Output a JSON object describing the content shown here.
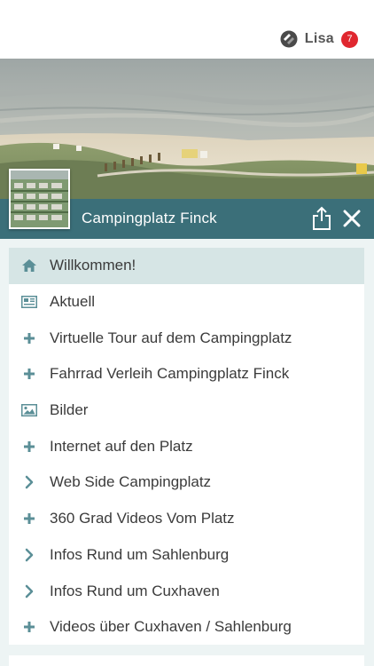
{
  "header": {
    "username": "Lisa",
    "badge_count": "7"
  },
  "camp": {
    "title": "Campingplatz Finck"
  },
  "colors": {
    "accent": "#3b6f79",
    "active_row": "#d6e5e5",
    "icon": "#5b8f97",
    "badge": "#e0272f"
  },
  "menu": {
    "items": [
      {
        "label": "Willkommen!",
        "icon": "home-icon",
        "active": true
      },
      {
        "label": "Aktuell",
        "icon": "newspaper-icon",
        "active": false
      },
      {
        "label": "Virtuelle Tour auf dem Campingplatz",
        "icon": "plus-icon",
        "active": false
      },
      {
        "label": "Fahrrad Verleih Campingplatz Finck",
        "icon": "plus-icon",
        "active": false
      },
      {
        "label": "Bilder",
        "icon": "image-icon",
        "active": false
      },
      {
        "label": "Internet auf den Platz",
        "icon": "plus-icon",
        "active": false
      },
      {
        "label": "Web Side Campingplatz",
        "icon": "chevron-right-icon",
        "active": false
      },
      {
        "label": "360 Grad Videos Vom Platz",
        "icon": "plus-icon",
        "active": false
      },
      {
        "label": "Infos Rund um Sahlenburg",
        "icon": "chevron-right-icon",
        "active": false
      },
      {
        "label": "Infos Rund um Cuxhaven",
        "icon": "chevron-right-icon",
        "active": false
      },
      {
        "label": "Videos über Cuxhaven / Sahlenburg",
        "icon": "plus-icon",
        "active": false
      }
    ]
  }
}
